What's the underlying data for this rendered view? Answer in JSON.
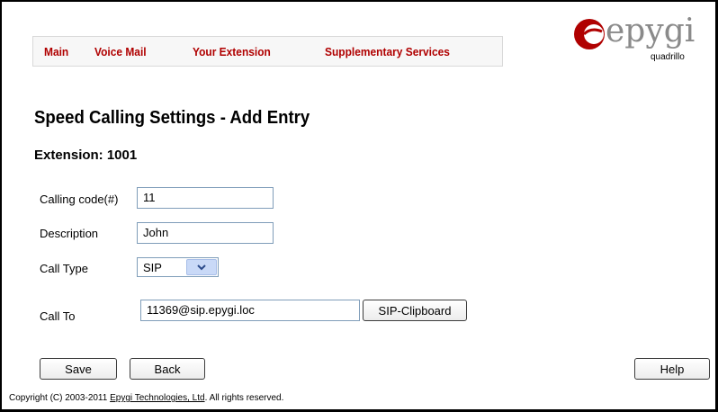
{
  "menu": {
    "items": [
      {
        "label": "Main"
      },
      {
        "label": "Voice Mail"
      },
      {
        "label": "Your Extension"
      },
      {
        "label": "Supplementary Services"
      }
    ]
  },
  "logo": {
    "word": "epygi",
    "sub": "quadrillo",
    "color": "#b00000"
  },
  "page": {
    "title": "Speed Calling Settings - Add Entry",
    "extension": "Extension: 1001"
  },
  "form": {
    "calling_code": {
      "label": "Calling code(#)",
      "value": "11"
    },
    "description": {
      "label": "Description",
      "value": "John"
    },
    "call_type": {
      "label": "Call Type",
      "value": "SIP"
    },
    "call_to": {
      "label": "Call To",
      "value": "11369@sip.epygi.loc"
    },
    "clipboard_button": "SIP-Clipboard"
  },
  "buttons": {
    "save": "Save",
    "back": "Back",
    "help": "Help"
  },
  "footer": {
    "prefix": "Copyright (C) 2003-2011 ",
    "link": "Epygi Technologies, Ltd",
    "suffix": ". All rights reserved."
  },
  "colors": {
    "menu_text": "#b00000",
    "input_border": "#7f9db9"
  }
}
